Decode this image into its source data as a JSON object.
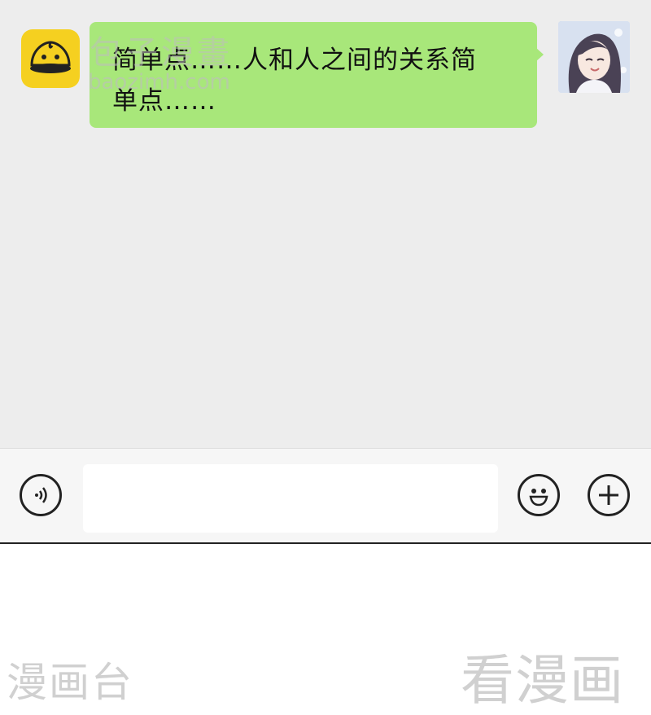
{
  "watermark": {
    "site_name": "包子漫畫",
    "site_url": "baozimh.com",
    "footer_left": "漫画台",
    "footer_right": "看漫画"
  },
  "chat": {
    "message_line1": "简单点……人和人之间的关系简",
    "message_line2": "单点……",
    "bubble_color": "#a8e77a",
    "background_color": "#ededed"
  },
  "input_bar": {
    "input_value": ""
  },
  "icons": {
    "logo": "bun-logo-icon",
    "avatar": "user-avatar",
    "voice": "voice-icon",
    "emoji": "emoji-icon",
    "plus": "plus-icon"
  }
}
